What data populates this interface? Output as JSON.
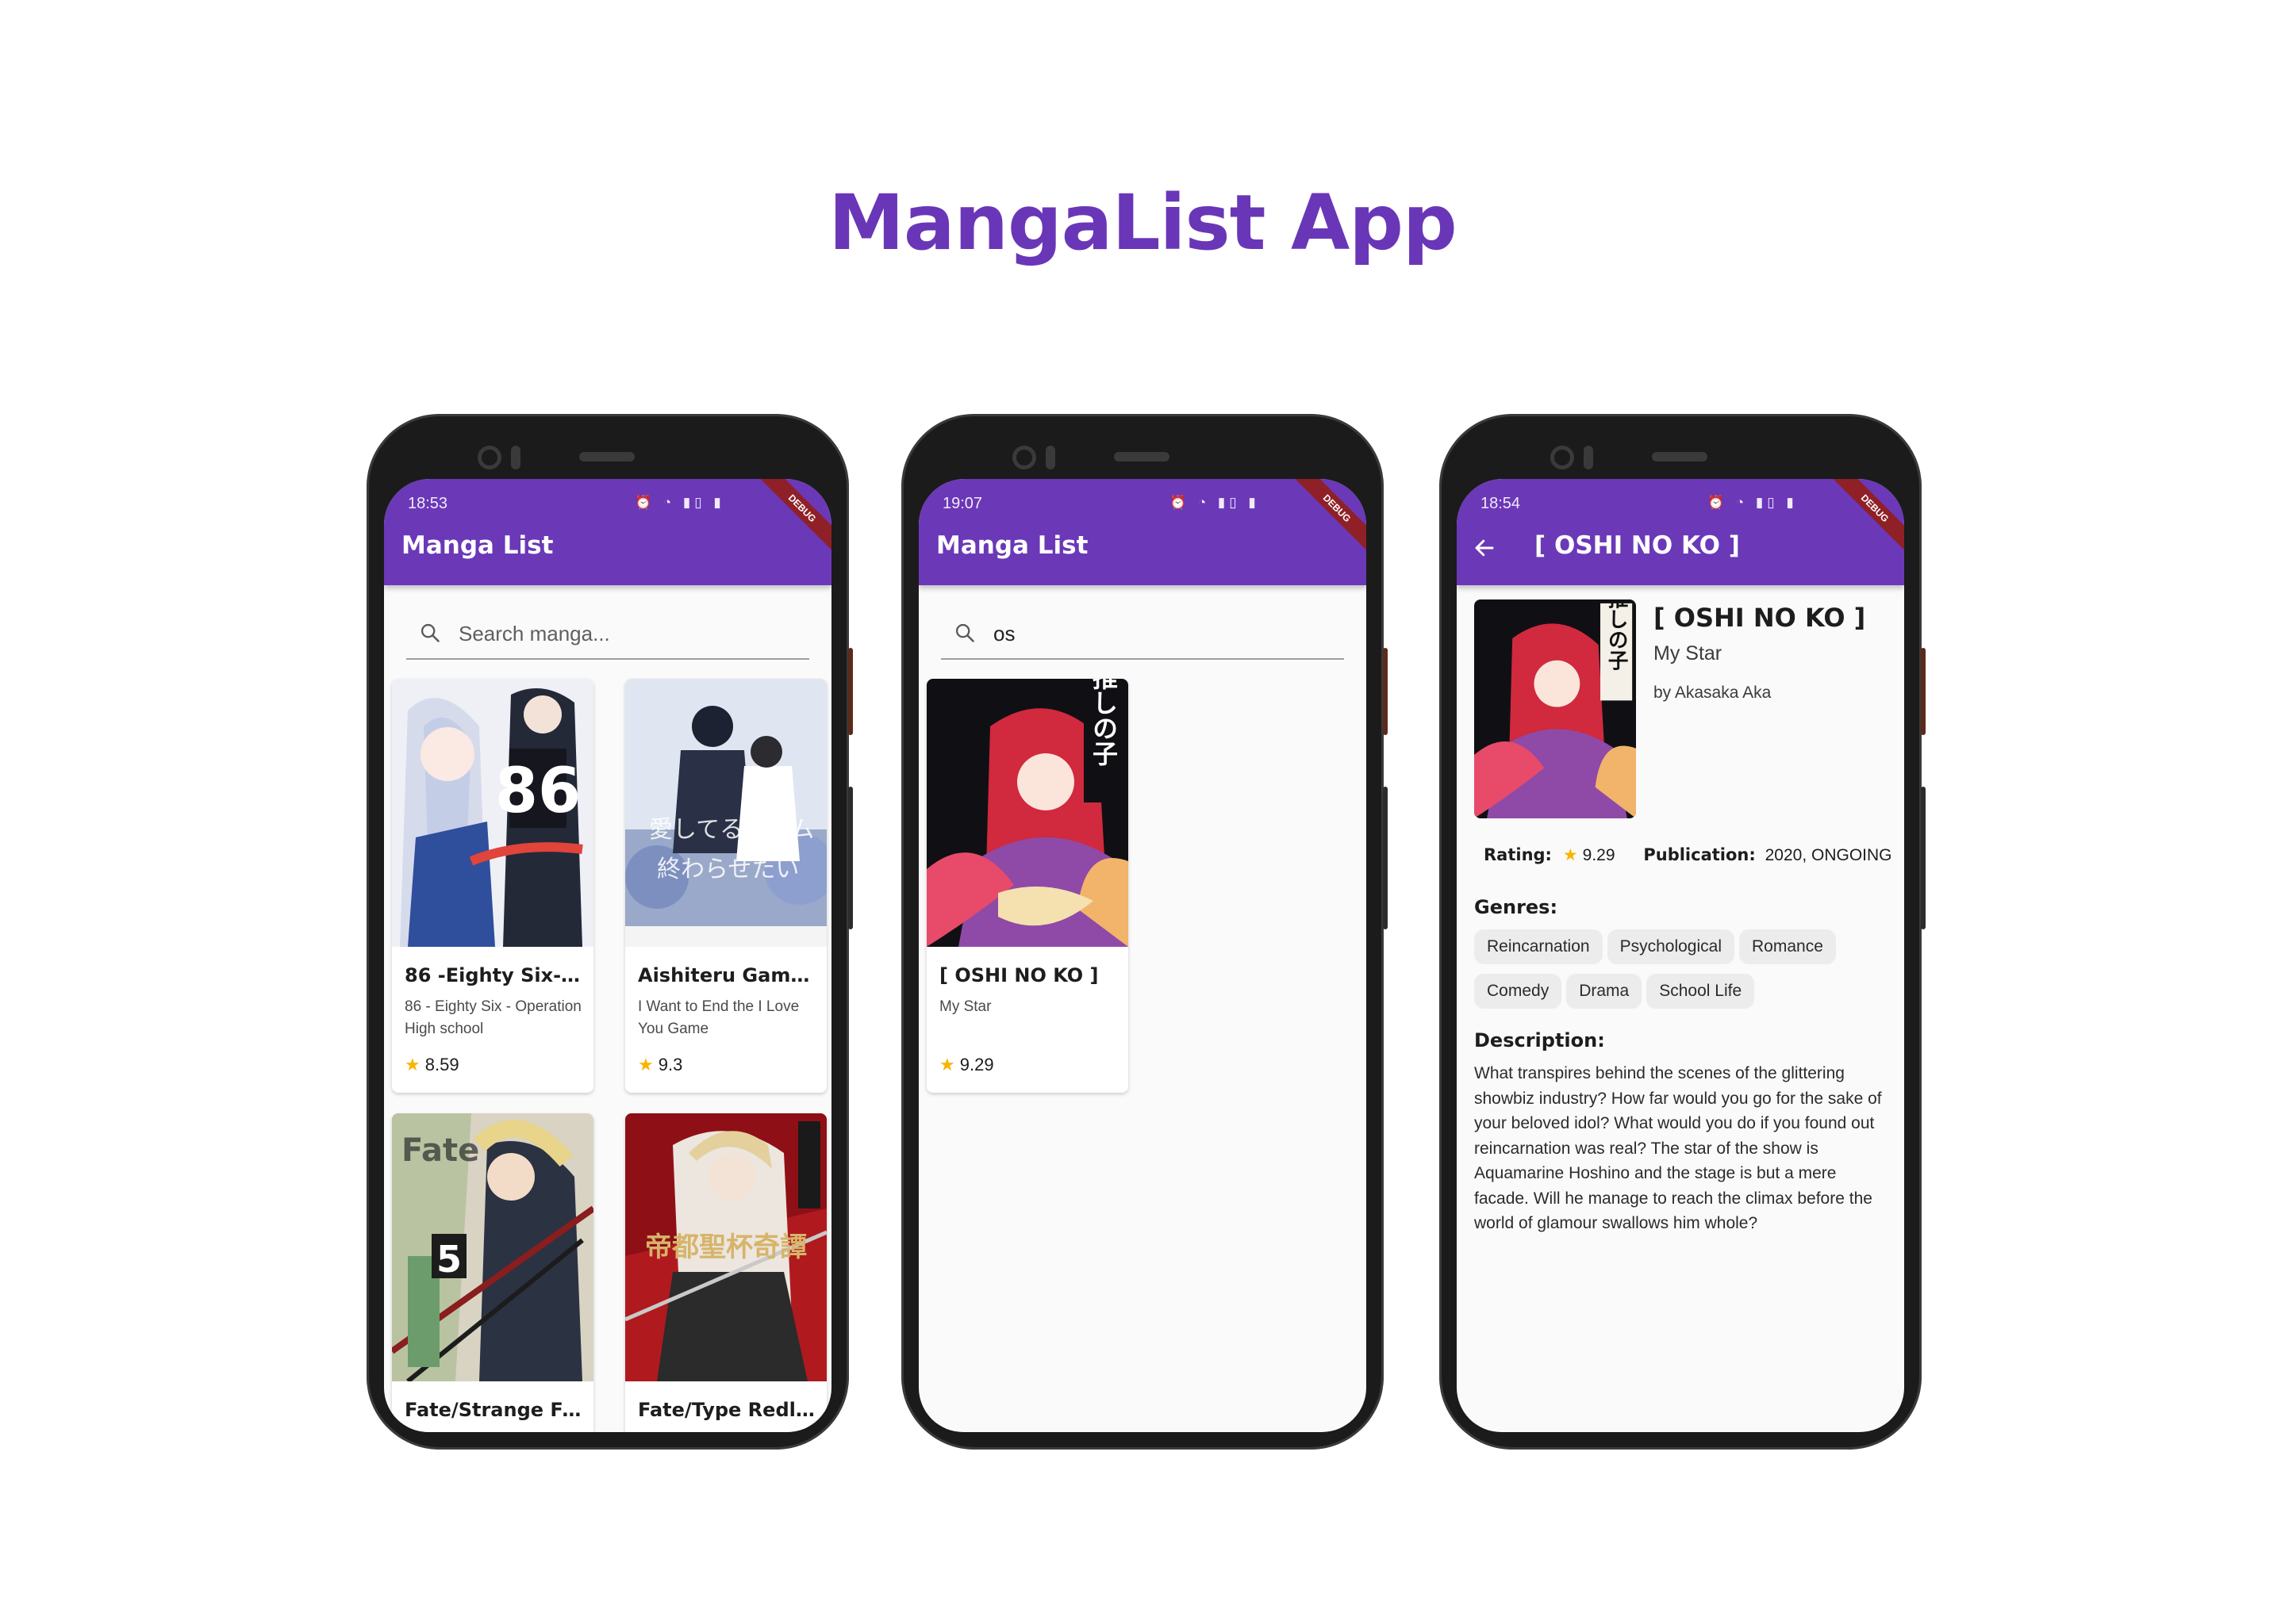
{
  "page_title": "MangaList App",
  "colors": {
    "app_bar": "#6b38b8",
    "title": "#6a36b8",
    "star": "#f7b500",
    "debug_banner": "#8f2027"
  },
  "phones": [
    {
      "status_time": "18:53",
      "status_icons": "⏰ ◔ ▮▯ ▮",
      "debug": "DEBUG",
      "app_title": "Manga List",
      "search": {
        "placeholder": "Search manga...",
        "value": ""
      },
      "cards": [
        {
          "title": "86 -Eighty Six- ...",
          "subtitle": "86 - Eighty Six - Operation High school",
          "rating": "8.59",
          "cover_label": "86"
        },
        {
          "title": "Aishiteru Game ...",
          "subtitle": "I Want to End the I Love You Game",
          "rating": "9.3",
          "cover_label": ""
        },
        {
          "title": "Fate/Strange Fa...",
          "cover_label": "5"
        },
        {
          "title": "Fate/Type Redli...",
          "cover_label": "帝都聖杯奇譚"
        }
      ]
    },
    {
      "status_time": "19:07",
      "status_icons": "⏰ ◔ ▮▯ ▮",
      "debug": "DEBUG",
      "app_title": "Manga List",
      "search": {
        "placeholder": "Search manga...",
        "value": "os"
      },
      "cards": [
        {
          "title": "[ OSHI NO KO ]",
          "subtitle": "My Star",
          "rating": "9.29",
          "cover_label": "推しの子"
        }
      ]
    },
    {
      "status_time": "18:54",
      "status_icons": "⏰ ◔ ▮▯ ▮",
      "debug": "DEBUG",
      "app_title": "[ OSHI NO KO ]",
      "detail": {
        "title": "[ OSHI NO KO ]",
        "subtitle": "My Star",
        "author": "by Akasaka Aka",
        "cover_label": "推しの子",
        "rating_label": "Rating:",
        "rating_value": "9.29",
        "publication_label": "Publication:",
        "publication_value": "2020, ONGOING",
        "genres_label": "Genres:",
        "genres": [
          "Reincarnation",
          "Psychological",
          "Romance",
          "Comedy",
          "Drama",
          "School Life"
        ],
        "description_label": "Description:",
        "description": "What transpires behind the scenes of the glittering showbiz industry? How far would you go for the sake of your beloved idol? What would you do if you found out reincarnation was real? The star of the show is Aquamarine Hoshino and the stage is but a mere facade. Will he manage to reach the climax before the world of glamour swallows him whole?"
      }
    }
  ]
}
